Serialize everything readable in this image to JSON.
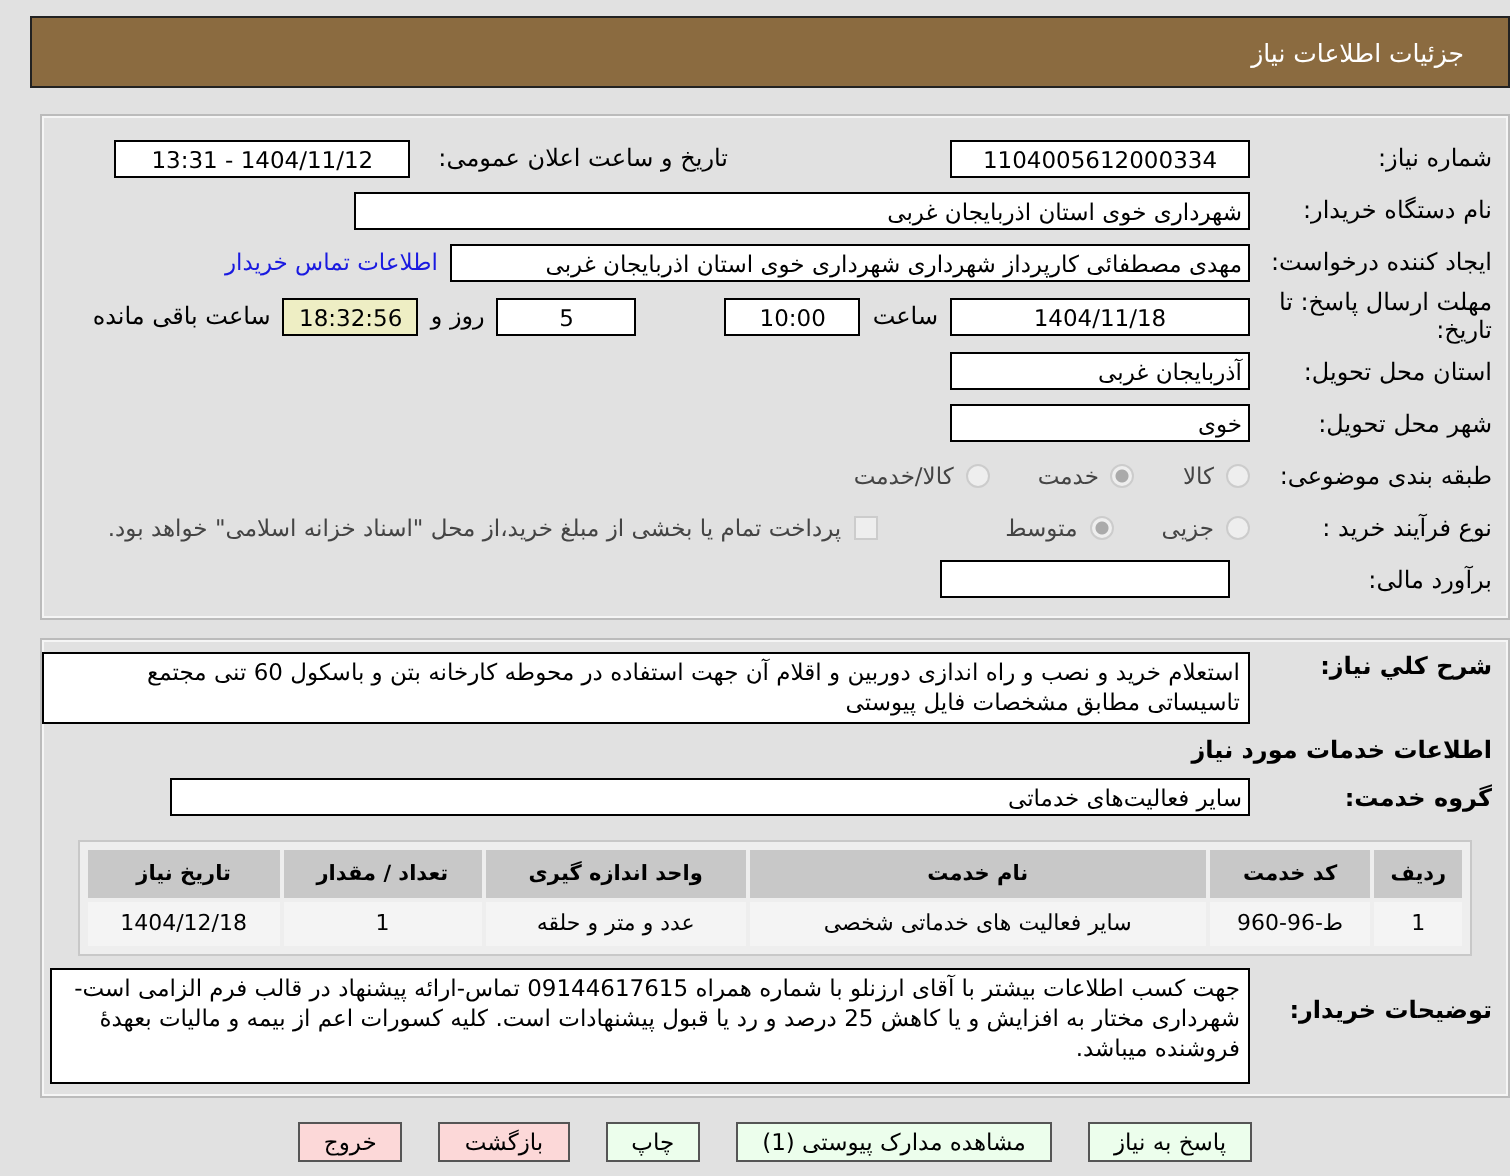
{
  "header": {
    "title": "جزئیات اطلاعات نیاز"
  },
  "need_number": {
    "label": "شماره نیاز:",
    "value": "1104005612000334"
  },
  "announce": {
    "label": "تاریخ و ساعت اعلان عمومی:",
    "value": "1404/11/12 - 13:31"
  },
  "buyer_org": {
    "label": "نام دستگاه خریدار:",
    "value": "شهرداری خوی استان اذربایجان غربی"
  },
  "requester": {
    "label": "ایجاد کننده درخواست:",
    "value": "مهدی مصطفائی کارپرداز شهرداری شهرداری خوی استان اذربایجان غربی",
    "link": "اطلاعات تماس خریدار"
  },
  "deadline": {
    "label": "مهلت ارسال پاسخ: تا تاریخ:",
    "date": "1404/11/18",
    "time_label": "ساعت",
    "time": "10:00",
    "days": "5",
    "days_label": "روز و",
    "remaining": "18:32:56",
    "remaining_label": "ساعت باقی مانده"
  },
  "province": {
    "label": "استان محل تحویل:",
    "value": "آذربایجان غربی"
  },
  "city": {
    "label": "شهر محل تحویل:",
    "value": "خوی"
  },
  "category": {
    "label": "طبقه بندی موضوعی:",
    "options": [
      {
        "label": "کالا",
        "selected": false
      },
      {
        "label": "خدمت",
        "selected": true
      },
      {
        "label": "کالا/خدمت",
        "selected": false
      }
    ]
  },
  "process": {
    "label": "نوع فرآیند خرید :",
    "options": [
      {
        "label": "جزیی",
        "selected": false
      },
      {
        "label": "متوسط",
        "selected": true
      }
    ],
    "treasury": {
      "checked": false,
      "text": "پرداخت تمام یا بخشی از مبلغ خرید،از محل \"اسناد خزانه اسلامی\" خواهد بود."
    }
  },
  "budget": {
    "label": "برآورد مالی:"
  },
  "description": {
    "label": "شرح کلي نياز:",
    "value": "استعلام خرید و نصب و راه اندازی دوربین و اقلام آن جهت استفاده در محوطه کارخانه بتن و باسکول 60 تنی مجتمع تاسیساتی مطابق مشخصات فایل پیوستی"
  },
  "services_heading": "اطلاعات خدمات مورد نياز",
  "service_group": {
    "label": "گروه خدمت:",
    "value": "سایر فعالیت‌های خدماتی"
  },
  "table": {
    "columns": [
      "ردیف",
      "کد خدمت",
      "نام خدمت",
      "واحد اندازه گیری",
      "تعداد / مقدار",
      "تاریخ نیاز"
    ],
    "rows": [
      [
        "1",
        "ط-96-960",
        "سایر فعالیت های خدماتی شخصی",
        "عدد و متر و حلقه",
        "1",
        "1404/12/18"
      ]
    ]
  },
  "buyer_notes": {
    "label": "توضیحات خریدار:",
    "value": "جهت کسب اطلاعات بیشتر با آقای ارزنلو با شماره همراه 09144617615 تماس-ارائه پیشنهاد در قالب فرم الزامی است-شهرداری مختار به افزایش و یا کاهش 25 درصد و رد یا قبول پیشنهادات است. کلیه کسورات اعم از بیمه و مالیات بعهدهٔ فروشنده میباشد."
  },
  "buttons": [
    {
      "label": "پاسخ به نیاز",
      "kind": "primary"
    },
    {
      "label": "مشاهده مدارک پیوستی (1)",
      "kind": "primary"
    },
    {
      "label": "چاپ",
      "kind": "primary"
    },
    {
      "label": "بازگشت",
      "kind": "danger"
    },
    {
      "label": "خروج",
      "kind": "danger"
    }
  ]
}
